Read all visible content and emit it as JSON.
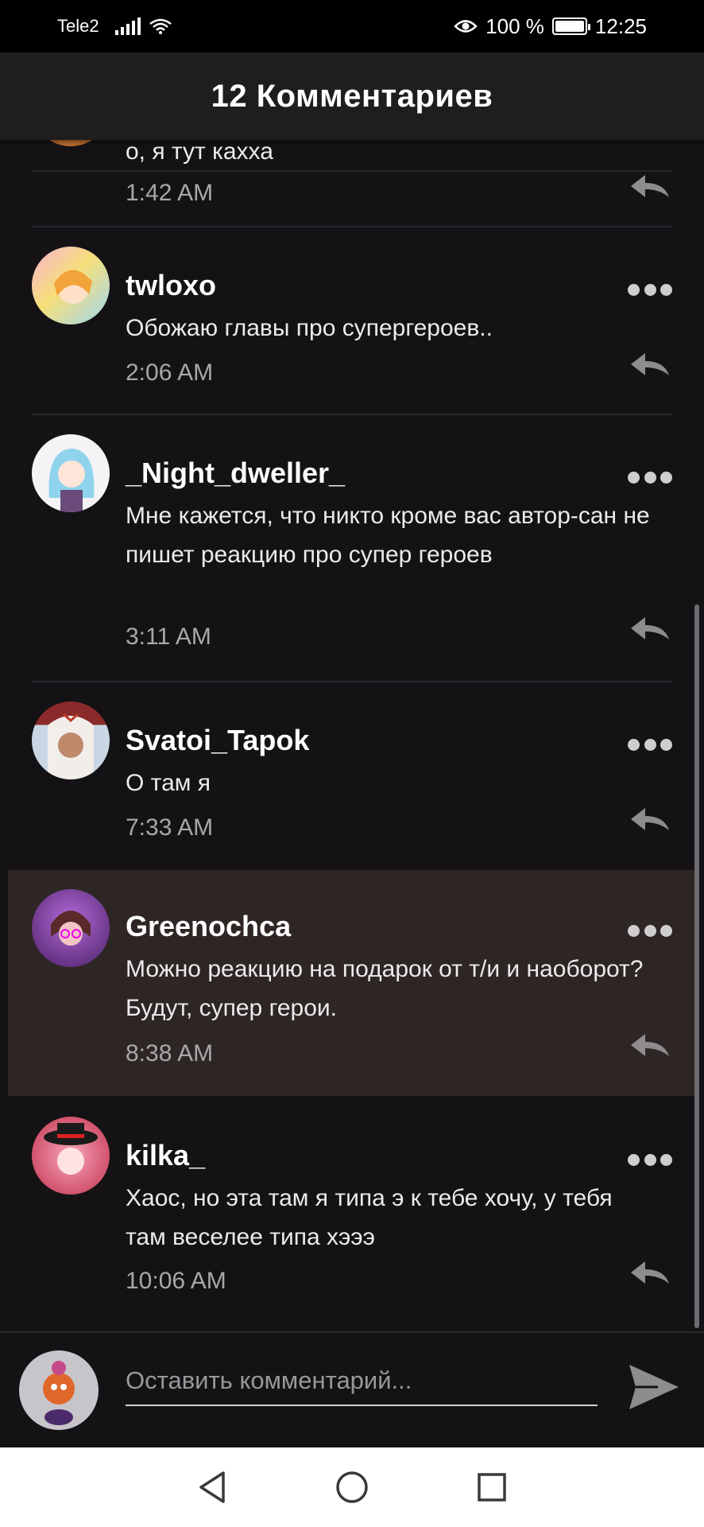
{
  "status_bar": {
    "carrier": "Tele2",
    "battery": "100 %",
    "time": "12:25"
  },
  "header": {
    "title": "12 Комментариев"
  },
  "comments": [
    {
      "username": "",
      "text": "о, я тут кахха",
      "time": "1:42 AM"
    },
    {
      "username": "twloxo",
      "text": "Обожаю главы про супергероев..",
      "time": "2:06 AM"
    },
    {
      "username": "_Night_dweller_",
      "text": "Мне кажется, что никто кроме вас автор-сан не пишет реакцию про супер героев",
      "time": "3:11 AM"
    },
    {
      "username": "Svatoi_Tapok",
      "text": "О там я",
      "time": "7:33 AM"
    },
    {
      "username": "Greenochca",
      "text": "Можно реакцию на подарок от т/и и наоборот? Будут, супер герои.",
      "time": "8:38 AM"
    },
    {
      "username": "kilka_",
      "text": "Хаос, но эта там я типа э к тебе хочу, у тебя там веселее типа хэээ",
      "time": "10:06 AM"
    }
  ],
  "input": {
    "placeholder": "Оставить комментарий..."
  },
  "icons": {
    "more": "more-dots-icon",
    "reply": "reply-arrow-icon",
    "send": "send-icon",
    "nav_back": "triangle-back-icon",
    "nav_home": "circle-home-icon",
    "nav_recent": "square-recent-icon"
  },
  "colors": {
    "background": "#141215",
    "header": "#1f1d20",
    "highlight": "#2e2624",
    "time_text": "#a9a7aa",
    "icon_gray": "#8e8c8f"
  }
}
